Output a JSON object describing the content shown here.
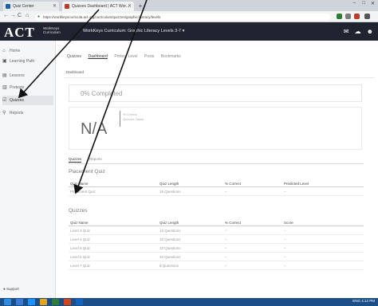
{
  "browser": {
    "tabs": [
      {
        "label": "Quiz Center",
        "fav_color": "#1f5fb0"
      },
      {
        "label": "Quizzes Dashboard | ACT Wor...",
        "fav_color": "#c0392b"
      }
    ],
    "new_tab_label": "+",
    "window_controls": [
      "–",
      "□",
      "✕"
    ],
    "nav": {
      "back": "←",
      "forward": "→",
      "reload": "C",
      "home": "⌂"
    },
    "url": "https://workkeyscurricula.act.org/curriculum/quizzes/graphic-literacy/levels",
    "extension_colors": [
      "#2e7d32",
      "#7b7b7b",
      "#c0392b",
      "#555555"
    ]
  },
  "app": {
    "logo": "ACT",
    "brand_sub": "WorkKeys Curriculum",
    "title": "WorkKeys Curriculum: Graphic Literacy Levels 3-7 ▾",
    "header_icons": [
      "mail-icon",
      "cloud-icon",
      "user-icon"
    ]
  },
  "sidebar": {
    "items": [
      {
        "icon": "⌂",
        "label": "Home",
        "name": "home"
      },
      {
        "icon": "▣",
        "label": "Learning Path",
        "name": "learning-path"
      },
      {
        "icon": "▤",
        "label": "Lessons",
        "name": "lessons"
      },
      {
        "icon": "▥",
        "label": "Pretests",
        "name": "pretests"
      },
      {
        "icon": "☑",
        "label": "Quizzes",
        "name": "quizzes",
        "active": true
      },
      {
        "icon": "⚲",
        "label": "Reports",
        "name": "reports"
      }
    ],
    "support": "● Support"
  },
  "main": {
    "crumb_tabs": [
      "Quizzes",
      "Dashboard",
      "Pretest Level",
      "Posts",
      "Bookmarks"
    ],
    "subhead": "Dashboard",
    "completion_label": "0% Completed",
    "na_value": "N/A",
    "na_sub": [
      "% Correct",
      "Quizzes Taken"
    ],
    "sub_tabs": [
      "Quizzes",
      "Reports"
    ],
    "pretest": {
      "heading": "Placement Quiz",
      "columns": [
        "Quiz Name",
        "Quiz Length",
        "% Correct",
        "Predicted Level"
      ],
      "rows": [
        [
          "Placement Quiz",
          "16 Questions",
          "–",
          "–"
        ]
      ]
    },
    "quizzes": {
      "heading": "Quizzes",
      "columns": [
        "Quiz Name",
        "Quiz Length",
        "% Correct",
        "Score"
      ],
      "rows": [
        [
          "Level 3 Quiz",
          "10 Questions",
          "–",
          "–"
        ],
        [
          "Level 4 Quiz",
          "10 Questions",
          "–",
          "–"
        ],
        [
          "Level 5 Quiz",
          "10 Questions",
          "–",
          "–"
        ],
        [
          "Level 6 Quiz",
          "10 Questions",
          "–",
          "–"
        ],
        [
          "Level 7 Quiz",
          "8 Questions",
          "–",
          "–"
        ]
      ]
    }
  },
  "taskbar": {
    "icon_colors": [
      "#2f8ae0",
      "#3a7bd5",
      "#1e90ff",
      "#e8a317",
      "#2e7d32",
      "#d84315",
      "#1565c0"
    ],
    "tray_text": "ENG 4:12 PM"
  }
}
